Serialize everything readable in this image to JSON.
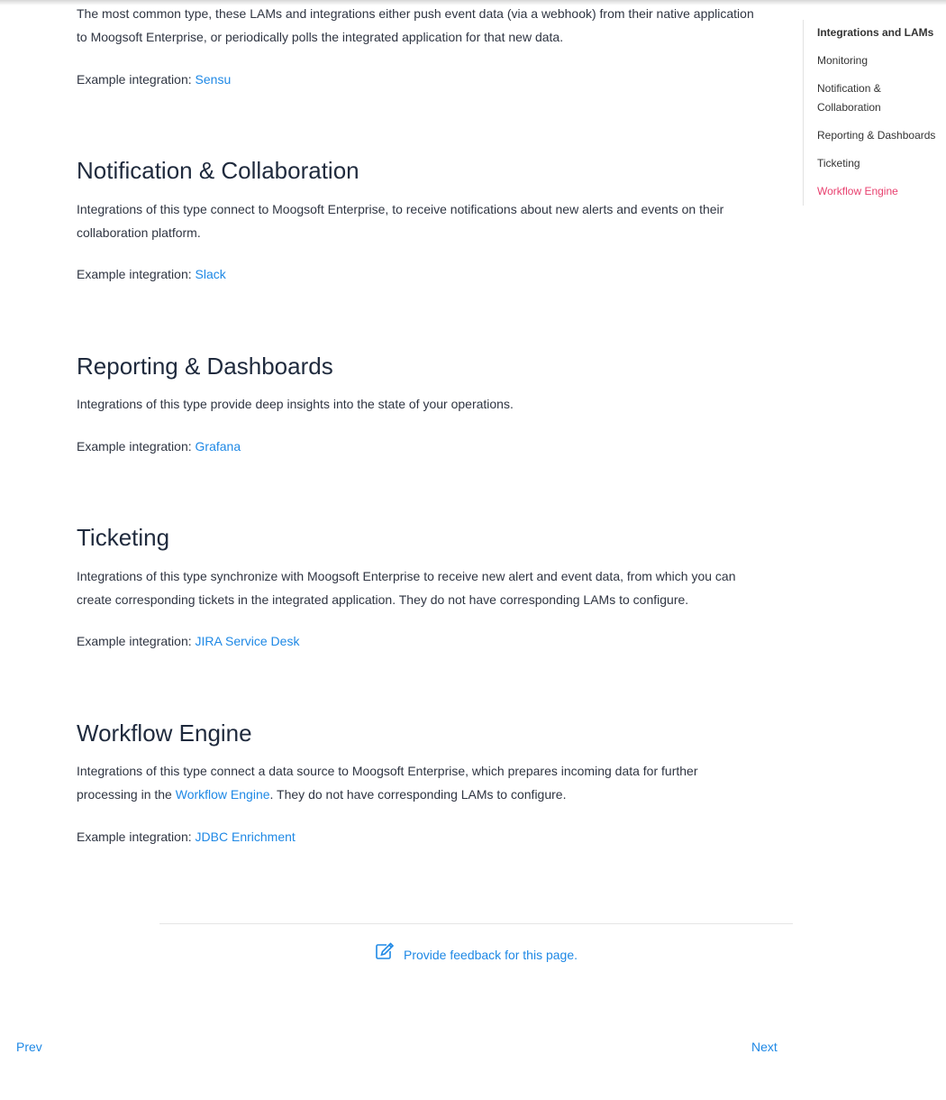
{
  "sections": {
    "intro": {
      "text": "The most common type, these LAMs and integrations either push event data (via a webhook) from their native application to Moogsoft Enterprise, or periodically polls the integrated application for that new data.",
      "example_prefix": "Example integration: ",
      "example_link": "Sensu"
    },
    "notification": {
      "heading": "Notification & Collaboration",
      "text": "Integrations of this type connect to Moogsoft Enterprise, to receive notifications about new alerts and events on their collaboration platform.",
      "example_prefix": "Example integration: ",
      "example_link": "Slack"
    },
    "reporting": {
      "heading": "Reporting & Dashboards",
      "text": "Integrations of this type provide deep insights into the state of your operations.",
      "example_prefix": "Example integration: ",
      "example_link": "Grafana"
    },
    "ticketing": {
      "heading": "Ticketing",
      "text": "Integrations of this type synchronize with Moogsoft Enterprise to receive new alert and event data, from which you can create corresponding tickets in the integrated application. They do not have corresponding LAMs to configure.",
      "example_prefix": "Example integration: ",
      "example_link": "JIRA Service Desk"
    },
    "workflow": {
      "heading": "Workflow Engine",
      "text_before": "Integrations of this type connect a data source to Moogsoft Enterprise, which prepares incoming data for further processing in the ",
      "text_link": "Workflow Engine",
      "text_after": ". They do not have corresponding LAMs to configure.",
      "example_prefix": "Example integration: ",
      "example_link": "JDBC Enrichment"
    }
  },
  "toc": {
    "items": [
      "Integrations and LAMs",
      "Monitoring",
      "Notification & Collaboration",
      "Reporting & Dashboards",
      "Ticketing",
      "Workflow Engine"
    ],
    "active_color": "#e8416f"
  },
  "feedback": {
    "label": "Provide feedback for this page.",
    "icon": "edit-icon"
  },
  "pager": {
    "prev": "Prev",
    "next": "Next"
  },
  "colors": {
    "link": "#1e88e5",
    "heading": "#1f2a3d",
    "body": "#2f3542"
  }
}
